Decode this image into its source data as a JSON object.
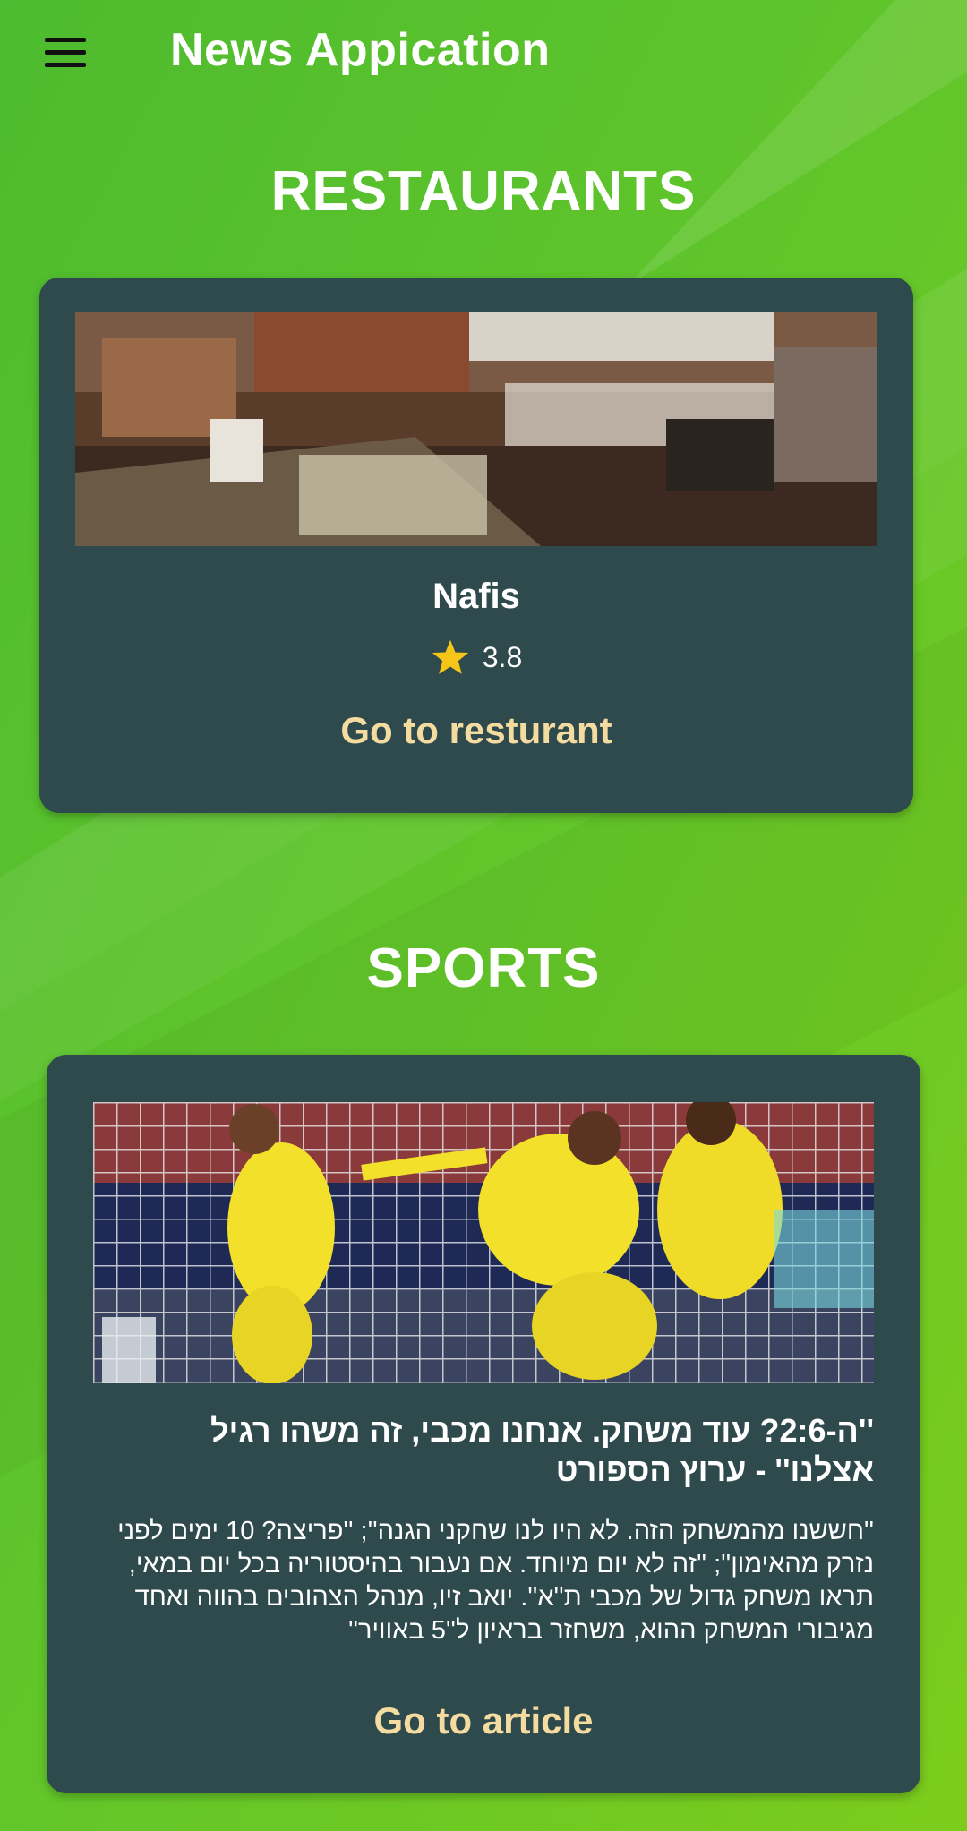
{
  "app": {
    "title": "News Appication"
  },
  "colors": {
    "background": "#5ec42b",
    "card": "#2e4a4c",
    "link": "#f4dba0",
    "star": "#f5c518"
  },
  "icons": {
    "menu": "menu-icon",
    "star": "star-icon"
  },
  "restaurants": {
    "section_title": "RESTAURANTS",
    "card": {
      "name": "Nafis",
      "rating": "3.8",
      "link_label": "Go to resturant"
    }
  },
  "sports": {
    "section_title": "SPORTS",
    "card": {
      "title": "''ה-2:6? עוד משחק. אנחנו מכבי, זה משהו רגיל אצלנו'' - ערוץ הספורט",
      "body": "''חששנו מהמשחק הזה. לא היו לנו שחקני הגנה''; ''פריצה? 10 ימים לפני נזרק מהאימון''; ''זה לא יום מיוחד. אם נעבור בהיסטוריה בכל יום במאי, תראו משחק גדול של מכבי ת''א''. יואב זיו, מנהל הצהובים בהווה ואחד מגיבורי המשחק ההוא, משחזר בראיון ל''5 באוויר''",
      "link_label": "Go to article"
    }
  }
}
